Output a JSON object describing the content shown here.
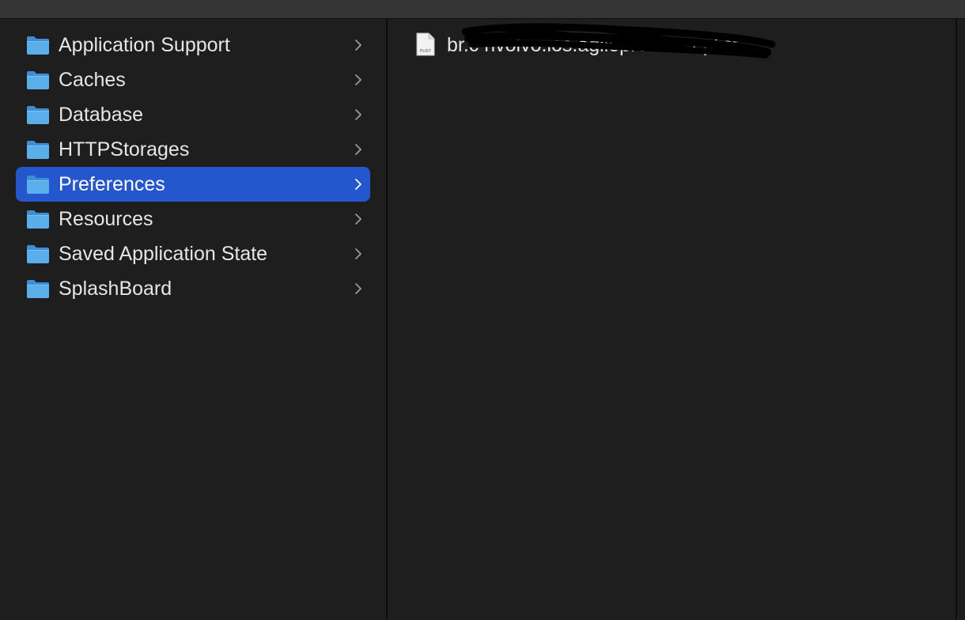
{
  "folders": [
    {
      "label": "Application Support",
      "selected": false
    },
    {
      "label": "Caches",
      "selected": false
    },
    {
      "label": "Database",
      "selected": false
    },
    {
      "label": "HTTPStorages",
      "selected": false
    },
    {
      "label": "Preferences",
      "selected": true
    },
    {
      "label": "Resources",
      "selected": false
    },
    {
      "label": "Saved Application State",
      "selected": false
    },
    {
      "label": "SplashBoard",
      "selected": false
    }
  ],
  "files": [
    {
      "label": "br.c     nvolvo.ios.agilepromoter.plist",
      "icon_caption": "PLIST"
    }
  ],
  "colors": {
    "selection": "#2456cd",
    "folder_icon": "#55a9e8",
    "background": "#1e1e1e"
  },
  "icons": {
    "folder": "folder-icon",
    "chevron": "chevron-right-icon",
    "file": "plist-file-icon"
  }
}
